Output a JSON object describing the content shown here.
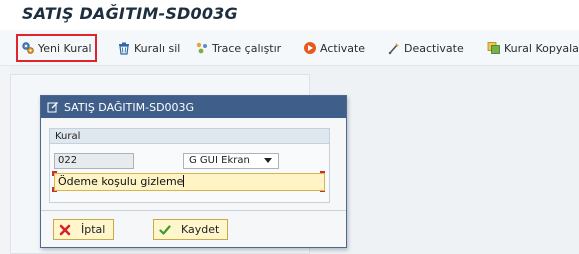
{
  "app": {
    "title": "SATIŞ DAĞITIM-SD003G"
  },
  "toolbar": {
    "items": [
      {
        "label": "Yeni Kural",
        "icon": "new-rule-icon"
      },
      {
        "label": "Kuralı sil",
        "icon": "trash-icon"
      },
      {
        "label": "Trace çalıştır",
        "icon": "trace-icon"
      },
      {
        "label": "Activate",
        "icon": "activate-icon"
      },
      {
        "label": "Deactivate",
        "icon": "deactivate-icon"
      },
      {
        "label": "Kural Kopyala",
        "icon": "copy-rule-icon"
      }
    ],
    "highlight_color": "#e0242b"
  },
  "dialog": {
    "title": "SATIŞ DAĞITIM-SD003G",
    "group_label": "Kural",
    "code_value": "022",
    "select_value": "G GUI Ekran",
    "text_value": "Ödeme koşulu gizleme",
    "buttons": [
      {
        "label": "İptal",
        "icon": "cancel-icon"
      },
      {
        "label": "Kaydet",
        "icon": "check-icon"
      }
    ]
  },
  "colors": {
    "dialog_header": "#3f5f8a",
    "input_highlight": "#fff4c6",
    "button_bg": "#fff6cc"
  }
}
